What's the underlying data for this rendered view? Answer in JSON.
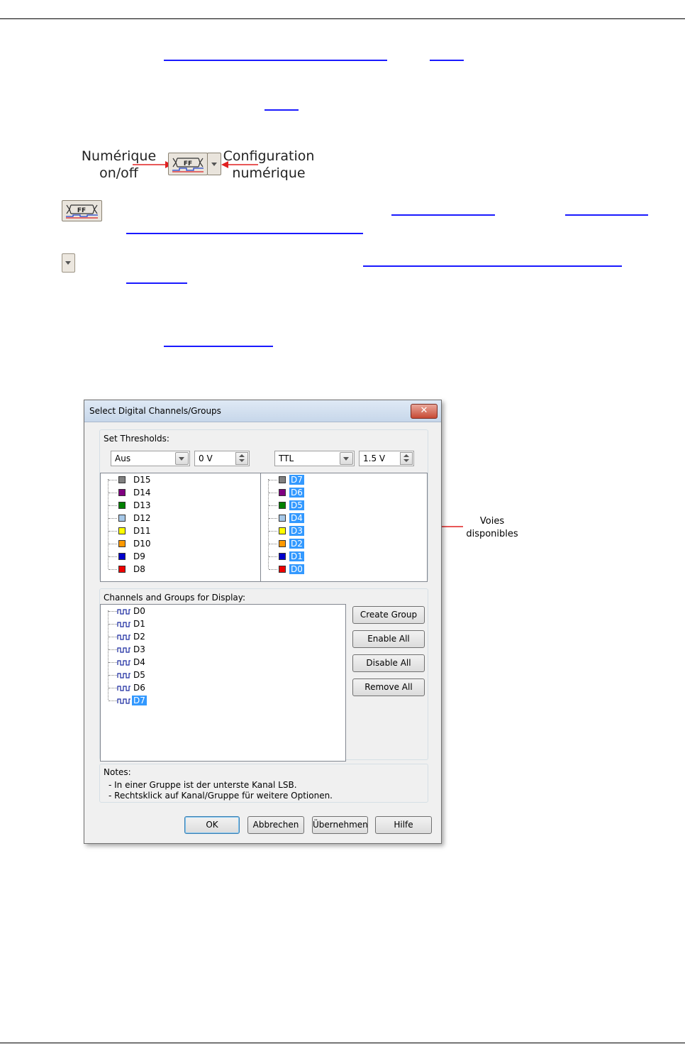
{
  "page": {
    "callout_left": [
      "Numérique",
      "on/off"
    ],
    "callout_right": [
      "Configuration",
      "numérique"
    ],
    "annotation": [
      "Voies",
      "disponibles"
    ]
  },
  "dialog": {
    "title": "Select Digital Channels/Groups",
    "close_glyph": "✕",
    "thresholds": {
      "label": "Set Thresholds:",
      "left_family": "Aus",
      "left_voltage": "0 V",
      "right_family": "TTL",
      "right_voltage": "1.5 V"
    },
    "left_channels": [
      {
        "name": "D15",
        "color": "#808080"
      },
      {
        "name": "D14",
        "color": "#800080"
      },
      {
        "name": "D13",
        "color": "#008000"
      },
      {
        "name": "D12",
        "color": "#a6c8e8"
      },
      {
        "name": "D11",
        "color": "#ffff00"
      },
      {
        "name": "D10",
        "color": "#ff9900"
      },
      {
        "name": "D9",
        "color": "#0000cc"
      },
      {
        "name": "D8",
        "color": "#ee0000"
      }
    ],
    "right_channels": [
      {
        "name": "D7",
        "color": "#808080"
      },
      {
        "name": "D6",
        "color": "#800080"
      },
      {
        "name": "D5",
        "color": "#008000"
      },
      {
        "name": "D4",
        "color": "#a6c8e8"
      },
      {
        "name": "D3",
        "color": "#ffff00"
      },
      {
        "name": "D2",
        "color": "#ff9900"
      },
      {
        "name": "D1",
        "color": "#0000cc"
      },
      {
        "name": "D0",
        "color": "#ee0000"
      }
    ],
    "display": {
      "label": "Channels and Groups for Display:",
      "items": [
        "D0",
        "D1",
        "D2",
        "D3",
        "D4",
        "D5",
        "D6",
        "D7"
      ],
      "selected": "D7",
      "wave_glyph": "ꟷꟷꟷ"
    },
    "side_buttons": [
      "Create Group",
      "Enable All",
      "Disable All",
      "Remove All"
    ],
    "notes": {
      "label": "Notes:",
      "lines": [
        "- In einer Gruppe ist der unterste Kanal LSB.",
        "- Rechtsklick auf Kanal/Gruppe für weitere Optionen."
      ]
    },
    "footer_buttons": {
      "ok": "OK",
      "cancel": "Abbrechen",
      "apply": "Übernehmen",
      "help": "Hilfe"
    }
  },
  "colors": {
    "link": "#1a1aff",
    "selection": "#3399ff",
    "arrow": "#e02020"
  }
}
